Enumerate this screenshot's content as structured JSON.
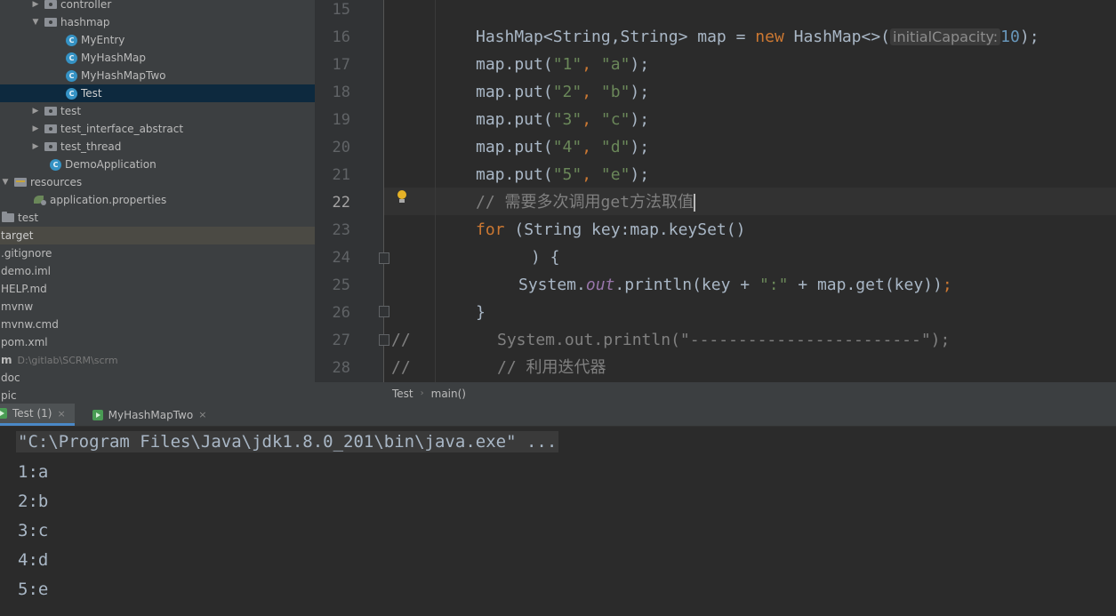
{
  "tree": {
    "items": [
      {
        "label": "controller",
        "hint": ""
      },
      {
        "label": "hashmap",
        "hint": ""
      },
      {
        "label": "MyEntry",
        "hint": ""
      },
      {
        "label": "MyHashMap",
        "hint": ""
      },
      {
        "label": "MyHashMapTwo",
        "hint": ""
      },
      {
        "label": "Test",
        "hint": ""
      },
      {
        "label": "test",
        "hint": ""
      },
      {
        "label": "test_interface_abstract",
        "hint": ""
      },
      {
        "label": "test_thread",
        "hint": ""
      },
      {
        "label": "DemoApplication",
        "hint": ""
      },
      {
        "label": "resources",
        "hint": ""
      },
      {
        "label": "application.properties",
        "hint": ""
      },
      {
        "label": "test",
        "hint": ""
      },
      {
        "label": "target",
        "hint": ""
      },
      {
        "label": ".gitignore",
        "hint": ""
      },
      {
        "label": "demo.iml",
        "hint": ""
      },
      {
        "label": "HELP.md",
        "hint": ""
      },
      {
        "label": "mvnw",
        "hint": ""
      },
      {
        "label": "mvnw.cmd",
        "hint": ""
      },
      {
        "label": "pom.xml",
        "hint": ""
      },
      {
        "label": "m",
        "hint": "D:\\gitlab\\SCRM\\scrm"
      },
      {
        "label": "doc",
        "hint": ""
      },
      {
        "label": "pic",
        "hint": ""
      }
    ],
    "class_icon_letter": "C"
  },
  "editor": {
    "line_numbers": [
      "15",
      "16",
      "17",
      "18",
      "19",
      "20",
      "21",
      "22",
      "23",
      "24",
      "25",
      "26",
      "27",
      "28"
    ],
    "active_line": "22",
    "lines": {
      "l16": {
        "t1": "HashMap<String,String> map = ",
        "kw": "new",
        "t2": " HashMap<>(",
        "hint": "initialCapacity:",
        "num": "10",
        "t3": ");"
      },
      "l17": {
        "t1": "map.put(",
        "s1": "\"1\"",
        "c": ", ",
        "s2": "\"a\"",
        "t2": ");"
      },
      "l18": {
        "t1": "map.put(",
        "s1": "\"2\"",
        "c": ", ",
        "s2": "\"b\"",
        "t2": ");"
      },
      "l19": {
        "t1": "map.put(",
        "s1": "\"3\"",
        "c": ", ",
        "s2": "\"c\"",
        "t2": ");"
      },
      "l20": {
        "t1": "map.put(",
        "s1": "\"4\"",
        "c": ", ",
        "s2": "\"d\"",
        "t2": ");"
      },
      "l21": {
        "t1": "map.put(",
        "s1": "\"5\"",
        "c": ", ",
        "s2": "\"e\"",
        "t2": ");"
      },
      "l22": {
        "comment": "// 需要多次调用get方法取值"
      },
      "l23": {
        "kw": "for",
        "t1": " (String key:map.keySet()"
      },
      "l24": {
        "t1": ") {"
      },
      "l25": {
        "t1": "System.",
        "field": "out",
        "t2": ".println(key + ",
        "s1": "\":\"",
        "t3": " + map.get(key))",
        "semi": ";"
      },
      "l26": {
        "t1": "}"
      },
      "l27": {
        "slashes": "//",
        "comment": "System.out.println(\"------------------------\");"
      },
      "l28": {
        "slashes": "//",
        "comment": "// 利用迭代器"
      }
    }
  },
  "breadcrumb": {
    "class_name": "Test",
    "method": "main()"
  },
  "run_tabs": [
    {
      "label": "Test (1)",
      "close": "×"
    },
    {
      "label": "MyHashMapTwo",
      "close": "×"
    }
  ],
  "console": {
    "command": "\"C:\\Program Files\\Java\\jdk1.8.0_201\\bin\\java.exe\" ...",
    "output": [
      "1:a",
      "2:b",
      "3:c",
      "4:d",
      "5:e"
    ]
  },
  "colors": {
    "keyword": "#cc7832",
    "string": "#6a8759",
    "comment": "#808080",
    "number": "#6897bb",
    "field": "#9876aa",
    "selection": "#0d293e",
    "accent": "#4a88c7"
  }
}
